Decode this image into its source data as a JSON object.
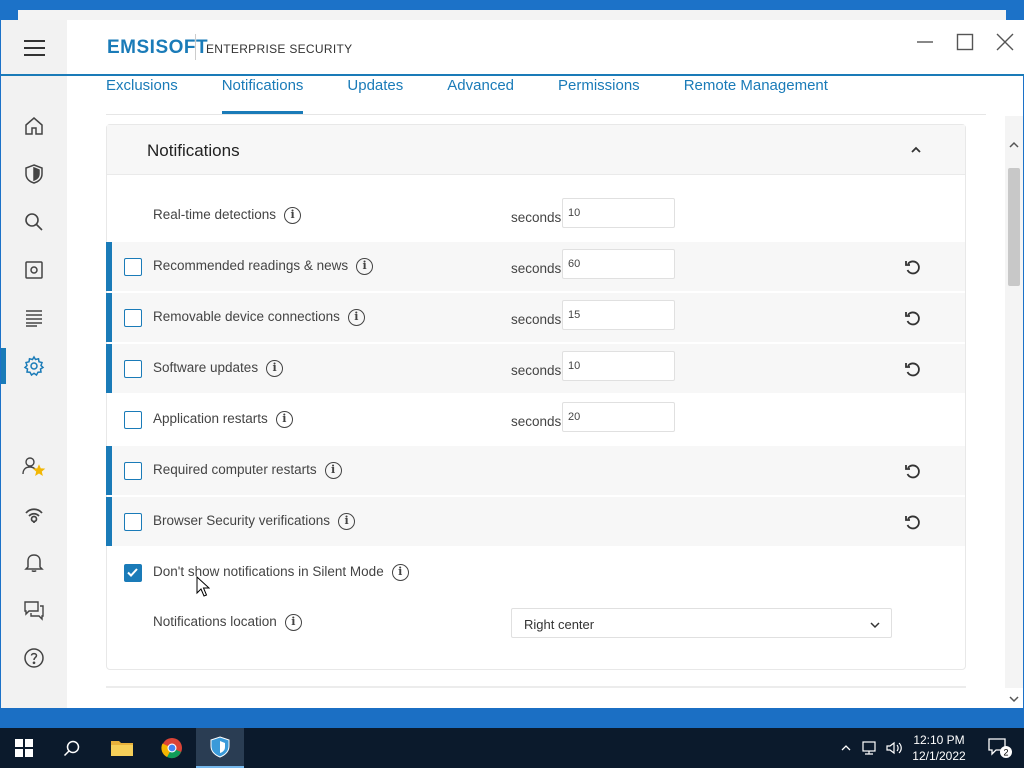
{
  "app": {
    "brand": "EMSISOFT",
    "product": "ENTERPRISE SECURITY"
  },
  "colors": {
    "accent": "#1a7bb8",
    "taskbar": "#0b1a2c",
    "desktop": "#1c72c8"
  },
  "sidebar": {
    "items": [
      {
        "name": "home-icon"
      },
      {
        "name": "shield-icon"
      },
      {
        "name": "search-icon"
      },
      {
        "name": "quarantine-icon"
      },
      {
        "name": "logs-icon"
      },
      {
        "name": "gear-icon",
        "active": true
      },
      {
        "name": "user-star-icon"
      },
      {
        "name": "network-icon"
      },
      {
        "name": "bell-icon"
      },
      {
        "name": "chat-icon"
      },
      {
        "name": "help-icon"
      }
    ]
  },
  "tabs": [
    {
      "label": "Exclusions",
      "active": false
    },
    {
      "label": "Notifications",
      "active": true
    },
    {
      "label": "Updates",
      "active": false
    },
    {
      "label": "Advanced",
      "active": false
    },
    {
      "label": "Permissions",
      "active": false
    },
    {
      "label": "Remote Management",
      "active": false
    }
  ],
  "panel": {
    "title": "Notifications",
    "seconds_label": "seconds",
    "rows": [
      {
        "label": "Real-time detections",
        "checkbox": false,
        "checked": false,
        "modified": false,
        "value": "10",
        "reset": false
      },
      {
        "label": "Recommended readings & news",
        "checkbox": true,
        "checked": false,
        "modified": true,
        "value": "60",
        "reset": true
      },
      {
        "label": "Removable device connections",
        "checkbox": true,
        "checked": false,
        "modified": true,
        "value": "15",
        "reset": true
      },
      {
        "label": "Software updates",
        "checkbox": true,
        "checked": false,
        "modified": true,
        "value": "10",
        "reset": true
      },
      {
        "label": "Application restarts",
        "checkbox": true,
        "checked": false,
        "modified": false,
        "value": "20",
        "reset": false
      },
      {
        "label": "Required computer restarts",
        "checkbox": true,
        "checked": false,
        "modified": true,
        "value": null,
        "reset": true
      },
      {
        "label": "Browser Security verifications",
        "checkbox": true,
        "checked": false,
        "modified": true,
        "value": null,
        "reset": true
      },
      {
        "label": "Don't show notifications in Silent Mode",
        "checkbox": true,
        "checked": true,
        "modified": false,
        "value": null,
        "reset": false
      }
    ],
    "location_label": "Notifications location",
    "location_value": "Right center"
  },
  "taskbar": {
    "time": "12:10 PM",
    "date": "12/1/2022",
    "notification_count": "2"
  }
}
